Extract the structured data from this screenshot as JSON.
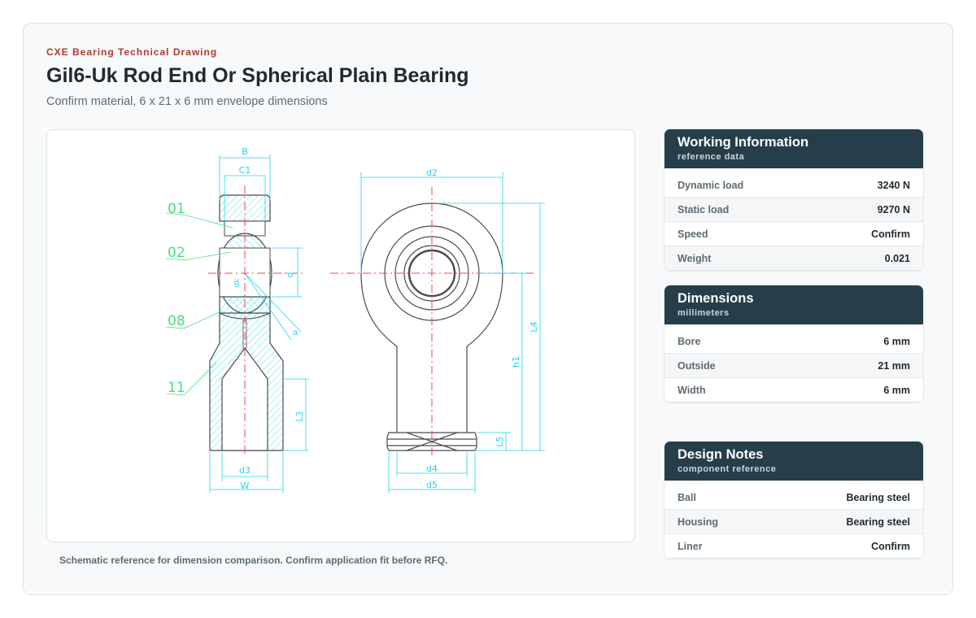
{
  "header": {
    "eyebrow": "CXE Bearing Technical Drawing",
    "title": "Gil6-Uk Rod End Or Spherical Plain Bearing",
    "subtitle": "Confirm material, 6 x 21 x 6 mm envelope dimensions"
  },
  "drawing": {
    "caption": "Schematic reference for dimension comparison. Confirm application fit before RFQ.",
    "part_labels": [
      "01",
      "02",
      "08",
      "11"
    ],
    "side_view_dims": [
      "B",
      "C1",
      "d",
      "dk",
      "α",
      "L3",
      "d3",
      "W"
    ],
    "front_view_dims": [
      "d2",
      "L4",
      "h1",
      "L5",
      "d4",
      "d5"
    ],
    "colors": {
      "outline": "#4a4a4a",
      "dimension": "#22d3ee",
      "label": "#4ade80",
      "centerline": "#ef4444"
    }
  },
  "panels": {
    "working": {
      "title": "Working Information",
      "subtitle": "reference data",
      "rows": [
        {
          "label": "Dynamic load",
          "value": "3240 N"
        },
        {
          "label": "Static load",
          "value": "9270 N"
        },
        {
          "label": "Speed",
          "value": "Confirm"
        },
        {
          "label": "Weight",
          "value": "0.021"
        }
      ]
    },
    "dimensions": {
      "title": "Dimensions",
      "subtitle": "millimeters",
      "rows": [
        {
          "label": "Bore",
          "value": "6 mm"
        },
        {
          "label": "Outside",
          "value": "21 mm"
        },
        {
          "label": "Width",
          "value": "6 mm"
        }
      ]
    },
    "notes": {
      "title": "Design Notes",
      "subtitle": "component reference",
      "rows": [
        {
          "label": "Ball",
          "value": "Bearing steel"
        },
        {
          "label": "Housing",
          "value": "Bearing steel"
        },
        {
          "label": "Liner",
          "value": "Confirm"
        }
      ]
    }
  }
}
